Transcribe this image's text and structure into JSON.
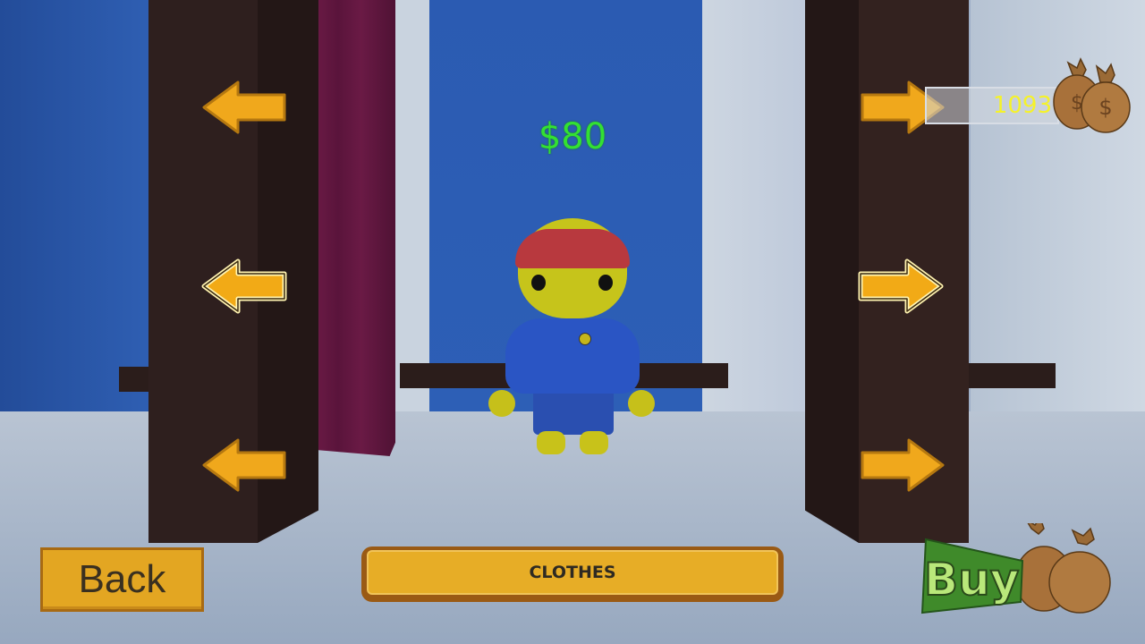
{
  "hud": {
    "price_label": "$80",
    "money_value": "1093",
    "money_icon": "money-bag-icon"
  },
  "buttons": {
    "back_label": "Back",
    "category_label": "CLOTHES",
    "buy_label": "Buy",
    "buy_icon": "money-bag-icon"
  },
  "arrows": {
    "row1_left": "arrow-left-icon",
    "row1_right": "arrow-right-icon",
    "row2_left": "arrow-left-icon",
    "row2_right": "arrow-right-icon",
    "row3_left": "arrow-left-icon",
    "row3_right": "arrow-right-icon",
    "row2_highlighted": true
  },
  "colors": {
    "price": "#33e033",
    "money": "#f5f22a",
    "button_fill": "#e3a622",
    "arrow_fill": "#f0a81c",
    "buy_text": "#b9e87a"
  }
}
